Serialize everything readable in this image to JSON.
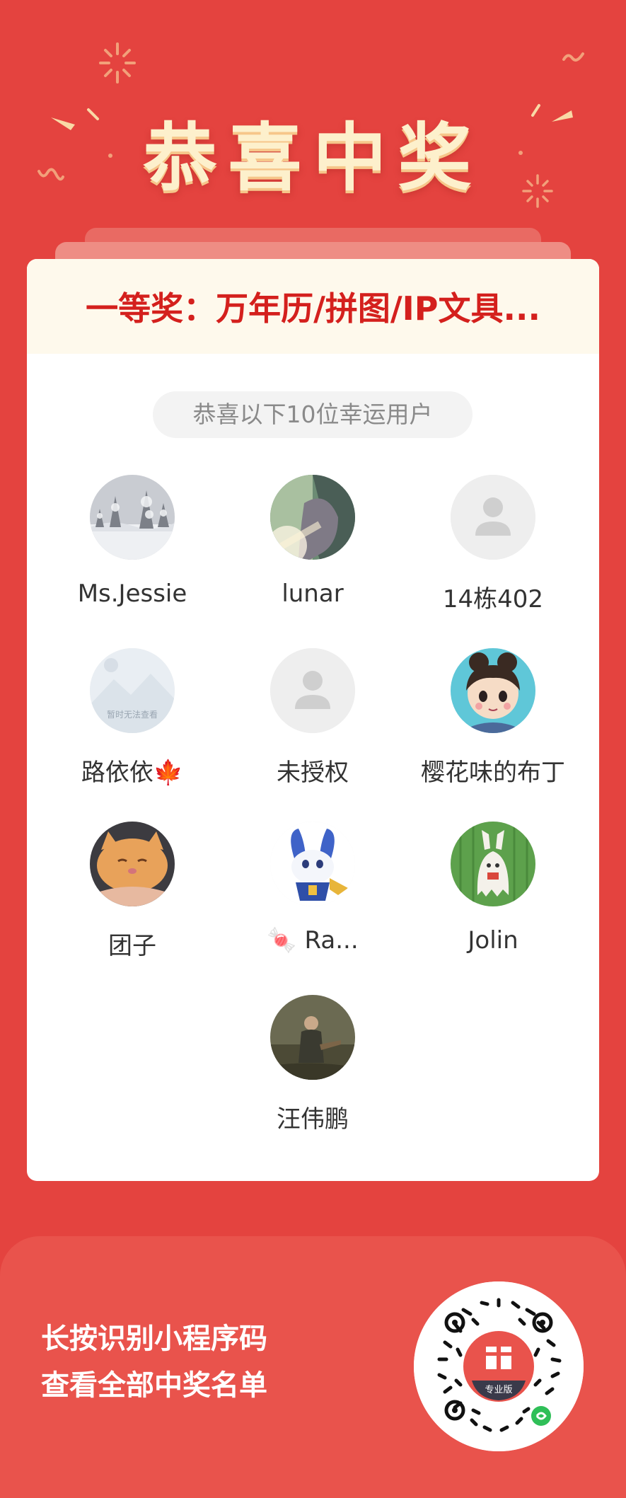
{
  "header": {
    "title": "恭喜中奖"
  },
  "prize": {
    "text": "一等奖：万年历/拼图/IP文具..."
  },
  "winners_caption": "恭喜以下10位幸运用户",
  "winners": [
    {
      "name": "Ms.Jessie",
      "avatar": "snowy-landscape-avatar"
    },
    {
      "name": "lunar",
      "avatar": "sunlit-portrait-avatar"
    },
    {
      "name": "14栋402",
      "avatar": "default-user-avatar"
    },
    {
      "name": "路依依🍁",
      "avatar": "unavailable-image-avatar",
      "avatar_text": "暂时无法查看"
    },
    {
      "name": "未授权",
      "avatar": "default-user-avatar"
    },
    {
      "name": "樱花味的布丁",
      "avatar": "cartoon-girl-avatar"
    },
    {
      "name": "团子",
      "avatar": "orange-cat-avatar"
    },
    {
      "name": "🍬 Ra...",
      "avatar": "blue-rabbit-avatar"
    },
    {
      "name": "Jolin",
      "avatar": "bunny-ghost-avatar"
    },
    {
      "name": "汪伟鹏",
      "avatar": "painting-figure-avatar"
    }
  ],
  "footer": {
    "line1": "长按识别小程序码",
    "line2": "查看全部中奖名单",
    "qr_badge": "专业版"
  },
  "colors": {
    "background": "#e4433f",
    "title": "#fdf0cc",
    "prize_text": "#d4201d",
    "footer": "#e9534c"
  }
}
